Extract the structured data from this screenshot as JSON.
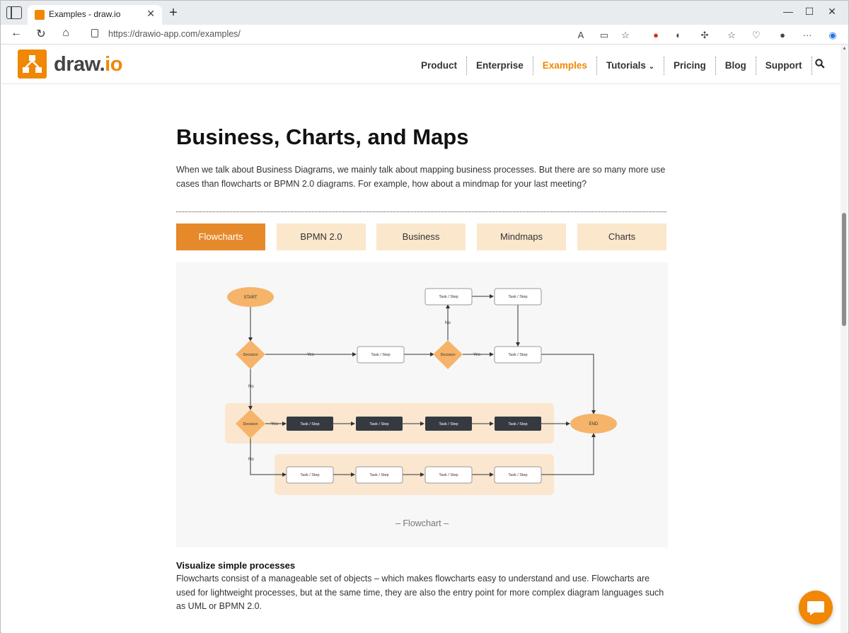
{
  "browser": {
    "tab_title": "Examples - draw.io",
    "url": "https://drawio-app.com/examples/"
  },
  "site": {
    "logo_text_main": "draw.",
    "logo_text_accent": "io",
    "nav": {
      "items": [
        "Product",
        "Enterprise",
        "Examples",
        "Tutorials",
        "Pricing",
        "Blog",
        "Support"
      ],
      "active": "Examples"
    }
  },
  "page": {
    "title": "Business, Charts, and Maps",
    "intro": "When we talk about Business Diagrams, we mainly talk about mapping business processes. But there are so many more use cases than flowcharts or BPMN 2.0 diagrams. For example, how about a mindmap for your last meeting?",
    "tabs": [
      "Flowcharts",
      "BPMN 2.0",
      "Business",
      "Mindmaps",
      "Charts"
    ],
    "active_tab": "Flowcharts",
    "caption": "– Flowchart –",
    "section_heading": "Visualize simple processes",
    "section_body": "Flowcharts consist of a manageable set of objects – which makes flowcharts easy to understand and use. Flowcharts are used for lightweight processes, but at the same time, they are also the entry point for more complex diagram languages such as UML or BPMN 2.0."
  },
  "flowchart": {
    "start": "START",
    "end": "END",
    "decision": "Decision",
    "task": "Task / Step",
    "yes": "Yes",
    "no": "No"
  },
  "colors": {
    "brand_orange": "#f08705",
    "active_tab": "#e6892b",
    "tab_bg": "#fbe7cc",
    "node_orange": "#f5b469",
    "lane_bg": "#fbe6cf",
    "dark_task": "#343a40"
  }
}
